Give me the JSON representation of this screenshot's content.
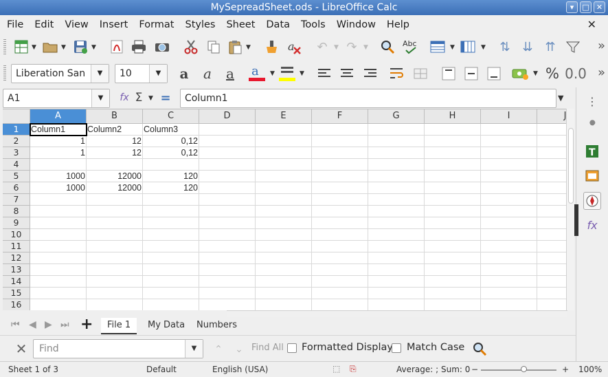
{
  "window": {
    "title": "MySepreadSheet.ods - LibreOffice Calc",
    "buttons": [
      "▾",
      "□",
      "✕"
    ]
  },
  "menubar": {
    "items": [
      "File",
      "Edit",
      "View",
      "Insert",
      "Format",
      "Styles",
      "Sheet",
      "Data",
      "Tools",
      "Window",
      "Help"
    ],
    "close": "✕"
  },
  "toolbar": {
    "font_name": "Liberation San",
    "font_size": "10",
    "icons_row1": [
      "new-icon",
      "open-icon",
      "save-icon",
      "export-pdf-icon",
      "print-icon",
      "print-preview-icon",
      "cut-icon",
      "copy-icon",
      "paste-icon",
      "clone-formatting-icon",
      "clear-formatting-icon",
      "undo-icon",
      "redo-icon",
      "find-replace-icon",
      "spelling-icon",
      "row-icon",
      "column-icon",
      "sort-icon",
      "sort-ascending-icon",
      "sort-descending-icon",
      "autofilter-icon"
    ],
    "icons_row2": [
      "bold-icon",
      "italic-icon",
      "underline-icon",
      "font-color-icon",
      "highlight-icon",
      "align-left-icon",
      "align-center-icon",
      "align-right-icon",
      "wrap-text-icon",
      "merge-cells-icon",
      "align-top-icon",
      "center-vertically-icon",
      "align-bottom-icon",
      "currency-icon",
      "percent-icon",
      "decimal-icon"
    ],
    "more": "»"
  },
  "formula_bar": {
    "name_box": "A1",
    "function_wizard": "fx",
    "sum": "Σ",
    "equals": "=",
    "content": "Column1"
  },
  "sheet": {
    "columns": [
      "A",
      "B",
      "C",
      "D",
      "E",
      "F",
      "G",
      "H",
      "I",
      "J"
    ],
    "rows": [
      "1",
      "2",
      "3",
      "4",
      "5",
      "6",
      "7",
      "8",
      "9",
      "10",
      "11",
      "12",
      "13",
      "14",
      "15",
      "16"
    ],
    "active_cell": "A1",
    "cells": [
      [
        "Column1",
        "Column2",
        "Column3"
      ],
      [
        "1",
        "12",
        "0,12"
      ],
      [
        "1",
        "12",
        "0,12"
      ],
      [
        "",
        "",
        ""
      ],
      [
        "1000",
        "12000",
        "120"
      ],
      [
        "1000",
        "12000",
        "120"
      ]
    ]
  },
  "tabs": {
    "items": [
      "File 1",
      "My Data",
      "Numbers"
    ],
    "active": "File 1",
    "add": "+"
  },
  "findbar": {
    "placeholder": "Find",
    "find_all": "Find All",
    "formatted_display": "Formatted Display",
    "match_case": "Match Case"
  },
  "statusbar": {
    "sheet": "Sheet 1 of 3",
    "style": "Default",
    "language": "English (USA)",
    "summary": "Average: ; Sum: 0",
    "zoom_minus": "−",
    "zoom_plus": "+",
    "zoom": "100%",
    "zoom_level": 1.0
  },
  "colors": {
    "titlebar": "#3b6fb6",
    "selected_header": "#4a8fd6",
    "font_color_bar": "#e8182e",
    "highlight_bar": "#ffff00"
  }
}
